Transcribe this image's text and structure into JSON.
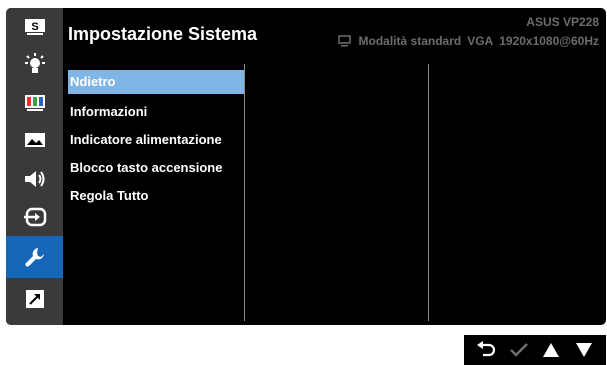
{
  "header": {
    "title": "Impostazione Sistema",
    "model": "ASUS  VP228",
    "mode": "Modalità standard",
    "input": "VGA",
    "resolution": "1920x1080@60Hz"
  },
  "sidebar": {
    "items": [
      {
        "icon": "splendid-s-icon",
        "active": false
      },
      {
        "icon": "bluelight-filter-icon",
        "active": false
      },
      {
        "icon": "color-bars-icon",
        "active": false
      },
      {
        "icon": "image-icon",
        "active": false
      },
      {
        "icon": "speaker-icon",
        "active": false
      },
      {
        "icon": "input-select-icon",
        "active": false
      },
      {
        "icon": "wrench-icon",
        "active": true
      },
      {
        "icon": "shortcut-icon",
        "active": false
      }
    ]
  },
  "menu": {
    "items": [
      {
        "label": "Ndietro",
        "selected": true
      },
      {
        "label": "Informazioni",
        "selected": false
      },
      {
        "label": "Indicatore alimentazione",
        "selected": false
      },
      {
        "label": "Blocco tasto accensione",
        "selected": false
      },
      {
        "label": "Regola Tutto",
        "selected": false
      }
    ]
  },
  "controls": [
    "back-icon",
    "check-icon",
    "up-icon",
    "down-icon"
  ],
  "colors": {
    "panel": "#000000",
    "sidebar": "#3a3a3a",
    "sidebar_active": "#1565b8",
    "selected_item": "#7fb6e6",
    "header_dim_text": "#6c6c6c"
  }
}
